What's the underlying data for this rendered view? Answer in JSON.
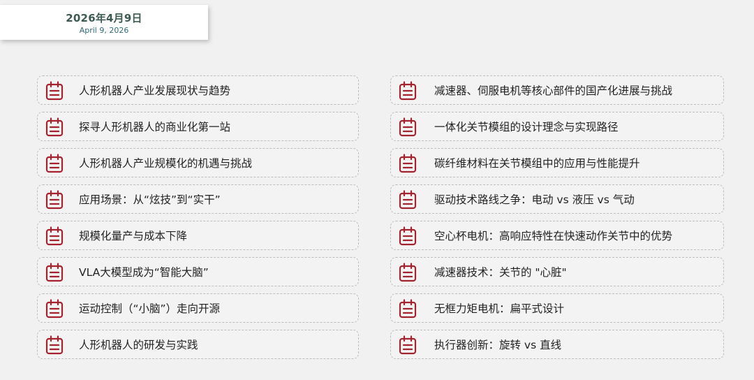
{
  "date": {
    "cn": "2026年4月9日",
    "en": "April 9, 2026"
  },
  "accent_color": "#a3242f",
  "icon": "calendar-icon",
  "left_items": [
    "人形机器人产业发展现状与趋势",
    "探寻人形机器人的商业化第一站",
    "人形机器人产业规模化的机遇与挑战",
    "应用场景：从“炫技”到“实干”",
    "规模化量产与成本下降",
    "VLA大模型成为“智能大脑”",
    "运动控制（“小脑”）走向开源",
    "人形机器人的研发与实践"
  ],
  "right_items": [
    "减速器、伺服电机等核心部件的国产化进展与挑战",
    "一体化关节模组的设计理念与实现路径",
    "碳纤维材料在关节模组中的应用与性能提升",
    "驱动技术路线之争：电动 vs 液压 vs 气动",
    "空心杯电机：高响应特性在快速动作关节中的优势",
    "减速器技术：关节的 \"心脏\"",
    "无框力矩电机：扁平式设计",
    "执行器创新：旋转 vs 直线"
  ]
}
